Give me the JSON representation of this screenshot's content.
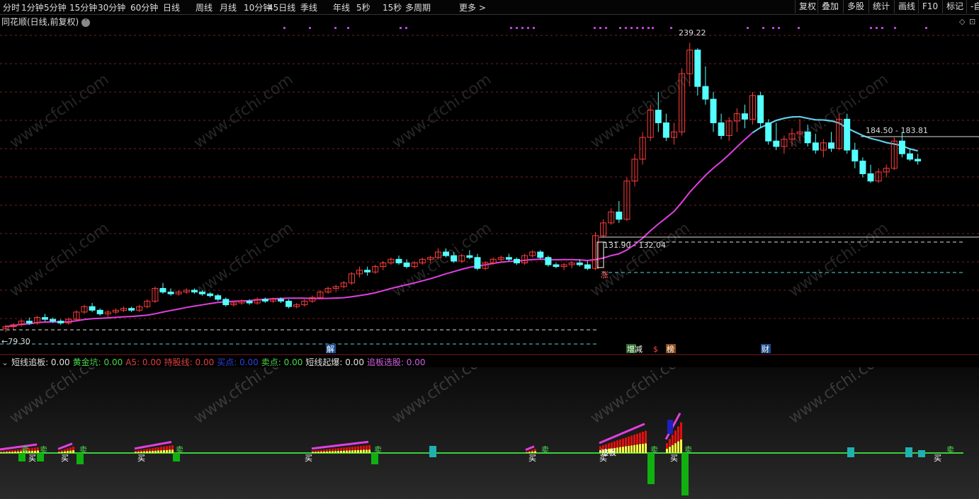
{
  "toolbar": {
    "periods": [
      "分时",
      "1分钟",
      "5分钟",
      "15分钟",
      "30分钟",
      "60分钟",
      "日线",
      "周线",
      "月线",
      "10分钟",
      "45日线",
      "季线",
      "年线",
      "5秒",
      "15秒",
      "多周期",
      "更多 >"
    ],
    "tools": [
      "复权",
      "叠加",
      "多股",
      "统计",
      "画线",
      "F10",
      "标记",
      "-自"
    ]
  },
  "main_chart": {
    "title": "同花顺(日线,前复权)",
    "high_label": "239.22",
    "low_label": "←79.30",
    "range_label_1": "184.50 - 183.81",
    "range_label_2": "131.90 - 132.04",
    "signals": {
      "jie": "解",
      "zhangjian": "增减",
      "dollar": "$",
      "bang": "榜",
      "cai": "财",
      "zhang": "涨"
    }
  },
  "indicator": {
    "values": [
      {
        "label": "短线追板",
        "value": "0.00",
        "color": "#e0e0e0"
      },
      {
        "label": "黄金坑",
        "value": "0.00",
        "color": "#4cd64c"
      },
      {
        "label": "A5",
        "value": "0.00",
        "color": "#e04040"
      },
      {
        "label": "持股线",
        "value": "0.00",
        "color": "#e04040"
      },
      {
        "label": "买点",
        "value": "0.00",
        "color": "#3040e0"
      },
      {
        "label": "卖点",
        "value": "0.00",
        "color": "#4cd64c"
      },
      {
        "label": "短线起爆",
        "value": "0.00",
        "color": "#e0e0e0"
      },
      {
        "label": "追板选股",
        "value": "0.00",
        "color": "#d060e0"
      }
    ],
    "buy_label": "买",
    "sell_label": "卖",
    "chase_label": "追板"
  },
  "watermark": "www.cfchi.com",
  "colors": {
    "up": "#ff3c3c",
    "down": "#54ffff",
    "ma": "#e040e0",
    "ma_tail": "#54d8e8",
    "grid": "#7a1e1e"
  },
  "chart_data": {
    "type": "candlestick",
    "ma_title": "",
    "candles": [
      [
        82,
        84,
        80,
        83
      ],
      [
        83,
        85,
        81,
        84
      ],
      [
        84,
        87,
        83,
        86
      ],
      [
        86,
        88,
        84,
        85
      ],
      [
        85,
        89,
        84,
        88
      ],
      [
        88,
        90,
        86,
        87
      ],
      [
        87,
        88,
        85,
        86
      ],
      [
        86,
        87,
        84,
        85
      ],
      [
        85,
        88,
        84,
        87
      ],
      [
        87,
        92,
        86,
        91
      ],
      [
        91,
        95,
        90,
        94
      ],
      [
        94,
        96,
        91,
        92
      ],
      [
        92,
        93,
        89,
        90
      ],
      [
        90,
        92,
        88,
        91
      ],
      [
        91,
        93,
        90,
        92
      ],
      [
        92,
        94,
        91,
        93
      ],
      [
        93,
        94,
        91,
        92
      ],
      [
        92,
        95,
        91,
        94
      ],
      [
        94,
        98,
        93,
        97
      ],
      [
        97,
        105,
        96,
        104
      ],
      [
        104,
        107,
        101,
        102
      ],
      [
        102,
        104,
        100,
        101
      ],
      [
        101,
        103,
        100,
        102
      ],
      [
        102,
        104,
        101,
        103
      ],
      [
        103,
        104,
        101,
        102
      ],
      [
        102,
        103,
        100,
        101
      ],
      [
        101,
        102,
        99,
        100
      ],
      [
        100,
        101,
        97,
        98
      ],
      [
        98,
        99,
        94,
        95
      ],
      [
        95,
        97,
        94,
        96
      ],
      [
        96,
        98,
        95,
        97
      ],
      [
        97,
        98,
        95,
        96
      ],
      [
        96,
        99,
        95,
        98
      ],
      [
        98,
        99,
        96,
        97
      ],
      [
        97,
        99,
        96,
        98
      ],
      [
        98,
        99,
        96,
        97
      ],
      [
        97,
        98,
        93,
        94
      ],
      [
        94,
        96,
        93,
        95
      ],
      [
        95,
        98,
        94,
        97
      ],
      [
        97,
        100,
        96,
        99
      ],
      [
        99,
        103,
        98,
        102
      ],
      [
        102,
        105,
        101,
        104
      ],
      [
        104,
        106,
        102,
        105
      ],
      [
        105,
        108,
        104,
        107
      ],
      [
        107,
        113,
        106,
        112
      ],
      [
        112,
        116,
        110,
        114
      ],
      [
        114,
        116,
        111,
        113
      ],
      [
        113,
        117,
        112,
        116
      ],
      [
        116,
        119,
        114,
        118
      ],
      [
        118,
        121,
        117,
        120
      ],
      [
        120,
        122,
        117,
        118
      ],
      [
        118,
        120,
        115,
        116
      ],
      [
        116,
        119,
        115,
        118
      ],
      [
        118,
        121,
        117,
        120
      ],
      [
        120,
        122,
        118,
        121
      ],
      [
        121,
        126,
        120,
        124
      ],
      [
        124,
        126,
        121,
        122
      ],
      [
        122,
        124,
        118,
        119
      ],
      [
        119,
        123,
        118,
        122
      ],
      [
        122,
        125,
        120,
        121
      ],
      [
        121,
        123,
        114,
        115
      ],
      [
        115,
        119,
        114,
        118
      ],
      [
        118,
        121,
        117,
        120
      ],
      [
        120,
        122,
        118,
        121
      ],
      [
        121,
        123,
        119,
        120
      ],
      [
        120,
        121,
        117,
        118
      ],
      [
        118,
        123,
        117,
        122
      ],
      [
        122,
        125,
        121,
        124
      ],
      [
        124,
        125,
        120,
        121
      ],
      [
        121,
        122,
        116,
        117
      ],
      [
        117,
        118,
        115,
        116
      ],
      [
        116,
        118,
        114,
        117
      ],
      [
        117,
        119,
        115,
        118
      ],
      [
        118,
        120,
        116,
        117
      ],
      [
        117,
        119,
        114,
        115
      ],
      [
        115,
        135,
        114,
        133
      ],
      [
        133,
        142,
        132,
        140
      ],
      [
        140,
        148,
        139,
        146
      ],
      [
        146,
        152,
        140,
        142
      ],
      [
        142,
        165,
        141,
        163
      ],
      [
        163,
        178,
        160,
        175
      ],
      [
        175,
        190,
        172,
        187
      ],
      [
        187,
        205,
        185,
        202
      ],
      [
        202,
        212,
        190,
        195
      ],
      [
        195,
        200,
        185,
        187
      ],
      [
        187,
        195,
        183,
        190
      ],
      [
        190,
        225,
        188,
        222
      ],
      [
        222,
        239,
        215,
        235
      ],
      [
        235,
        236,
        210,
        215
      ],
      [
        215,
        226,
        205,
        208
      ],
      [
        208,
        212,
        190,
        195
      ],
      [
        195,
        200,
        186,
        188
      ],
      [
        188,
        198,
        185,
        196
      ],
      [
        196,
        203,
        190,
        200
      ],
      [
        200,
        205,
        192,
        197
      ],
      [
        197,
        212,
        194,
        210
      ],
      [
        210,
        212,
        192,
        195
      ],
      [
        195,
        197,
        183,
        185
      ],
      [
        185,
        195,
        180,
        182
      ],
      [
        182,
        188,
        178,
        186
      ],
      [
        186,
        192,
        182,
        189
      ],
      [
        189,
        197,
        185,
        190
      ],
      [
        190,
        194,
        182,
        184
      ],
      [
        184,
        189,
        178,
        180
      ],
      [
        180,
        186,
        176,
        184
      ],
      [
        184,
        190,
        179,
        181
      ],
      [
        181,
        200,
        180,
        197
      ],
      [
        197,
        200,
        178,
        180
      ],
      [
        180,
        184,
        170,
        174
      ],
      [
        174,
        176,
        165,
        167
      ],
      [
        167,
        172,
        162,
        163
      ],
      [
        163,
        170,
        162,
        168
      ],
      [
        168,
        172,
        165,
        170
      ],
      [
        170,
        187,
        169,
        185
      ],
      [
        185,
        190,
        176,
        178
      ],
      [
        178,
        181,
        174,
        175
      ],
      [
        175,
        178,
        172,
        174
      ]
    ],
    "ma": [
      82,
      83,
      84,
      85,
      86,
      87,
      88,
      90,
      92,
      94,
      96,
      98,
      99,
      100,
      101,
      102,
      103,
      104,
      105,
      106,
      107,
      108,
      109,
      110,
      110,
      111,
      112,
      113,
      114,
      116,
      118,
      120,
      122,
      124,
      125,
      126,
      127,
      128,
      130,
      132,
      138,
      146,
      155,
      164,
      172,
      180,
      186,
      191,
      195,
      197,
      198,
      198,
      197,
      195,
      193,
      191,
      190,
      189,
      189
    ],
    "signal_rows": [
      "buy",
      "sell"
    ]
  }
}
